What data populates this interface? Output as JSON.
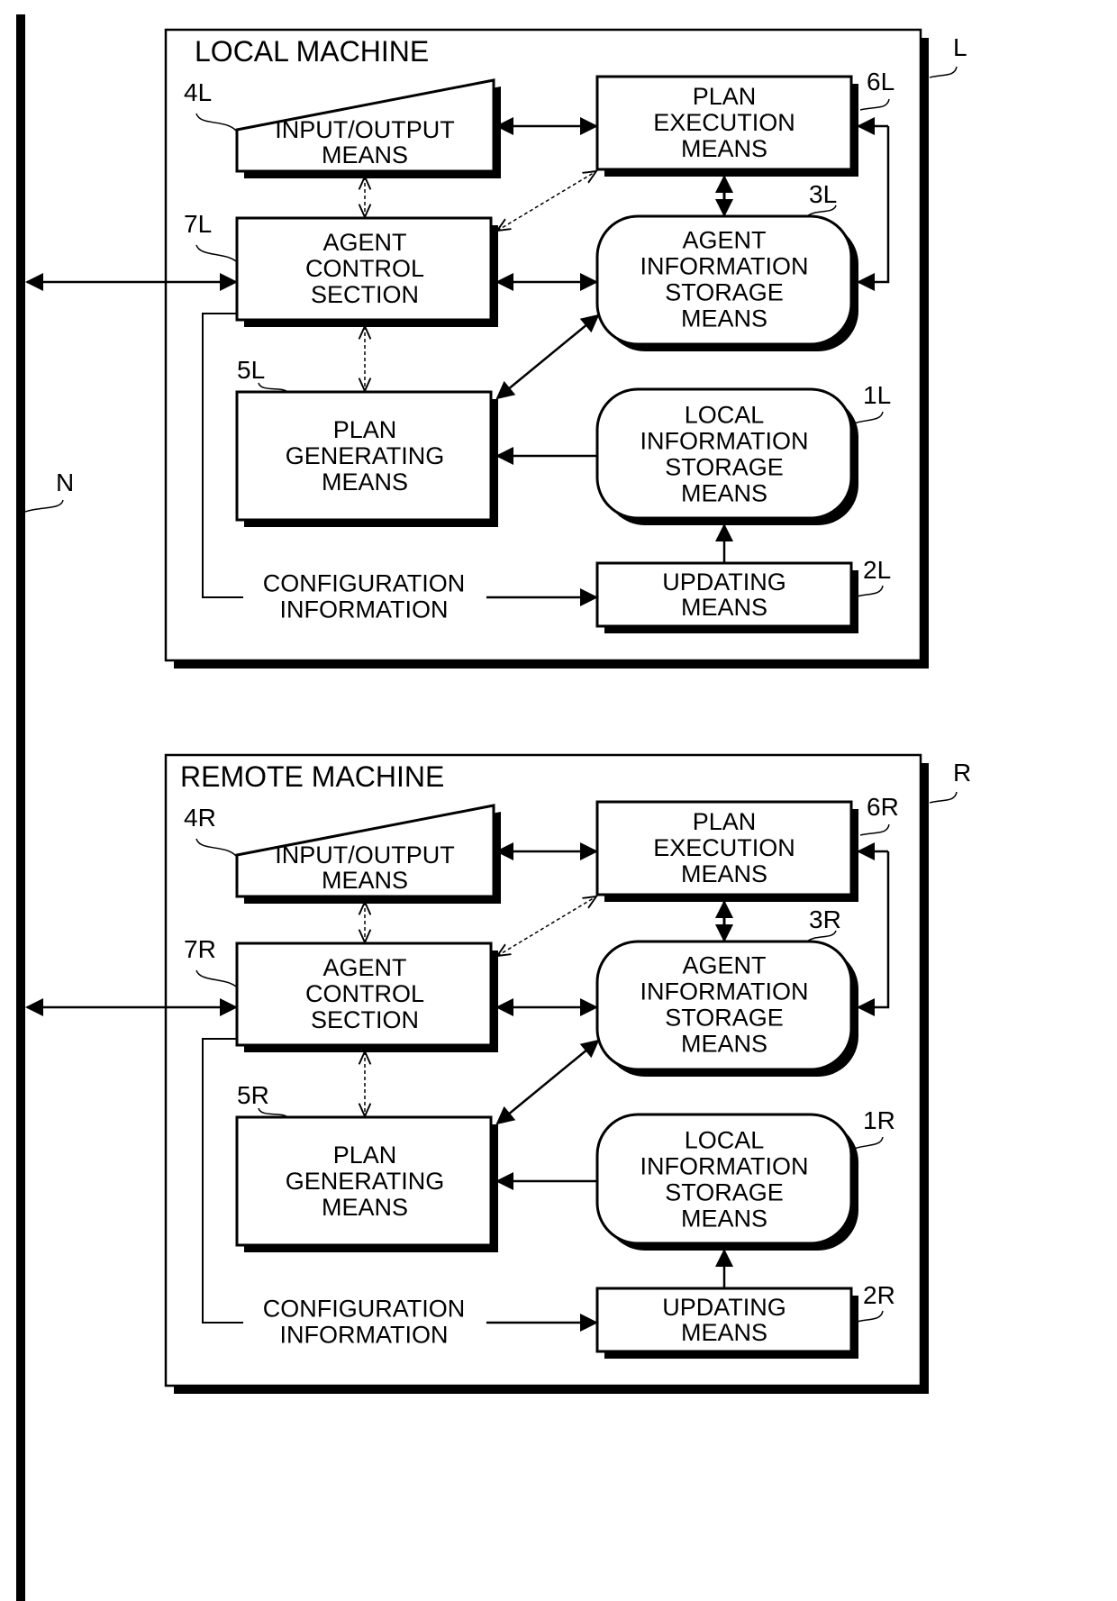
{
  "network": {
    "ref": "N"
  },
  "machines": [
    {
      "id": "local",
      "title": "LOCAL MACHINE",
      "ref": "L",
      "blocks": {
        "io": {
          "ref": "4L",
          "lines": [
            "INPUT/OUTPUT",
            "MEANS"
          ]
        },
        "exec": {
          "ref": "6L",
          "lines": [
            "PLAN",
            "EXECUTION",
            "MEANS"
          ]
        },
        "control": {
          "ref": "7L",
          "lines": [
            "AGENT",
            "CONTROL",
            "SECTION"
          ]
        },
        "agentinfo": {
          "ref": "3L",
          "lines": [
            "AGENT",
            "INFORMATION",
            "STORAGE",
            "MEANS"
          ]
        },
        "plangen": {
          "ref": "5L",
          "lines": [
            "PLAN",
            "GENERATING",
            "MEANS"
          ]
        },
        "localinfo": {
          "ref": "1L",
          "lines": [
            "LOCAL",
            "INFORMATION",
            "STORAGE",
            "MEANS"
          ]
        },
        "updating": {
          "ref": "2L",
          "lines": [
            "UPDATING",
            "MEANS"
          ]
        }
      },
      "config_label": [
        "CONFIGURATION",
        "INFORMATION"
      ]
    },
    {
      "id": "remote",
      "title": "REMOTE MACHINE",
      "ref": "R",
      "blocks": {
        "io": {
          "ref": "4R",
          "lines": [
            "INPUT/OUTPUT",
            "MEANS"
          ]
        },
        "exec": {
          "ref": "6R",
          "lines": [
            "PLAN",
            "EXECUTION",
            "MEANS"
          ]
        },
        "control": {
          "ref": "7R",
          "lines": [
            "AGENT",
            "CONTROL",
            "SECTION"
          ]
        },
        "agentinfo": {
          "ref": "3R",
          "lines": [
            "AGENT",
            "INFORMATION",
            "STORAGE",
            "MEANS"
          ]
        },
        "plangen": {
          "ref": "5R",
          "lines": [
            "PLAN",
            "GENERATING",
            "MEANS"
          ]
        },
        "localinfo": {
          "ref": "1R",
          "lines": [
            "LOCAL",
            "INFORMATION",
            "STORAGE",
            "MEANS"
          ]
        },
        "updating": {
          "ref": "2R",
          "lines": [
            "UPDATING",
            "MEANS"
          ]
        }
      },
      "config_label": [
        "CONFIGURATION",
        "INFORMATION"
      ]
    }
  ]
}
